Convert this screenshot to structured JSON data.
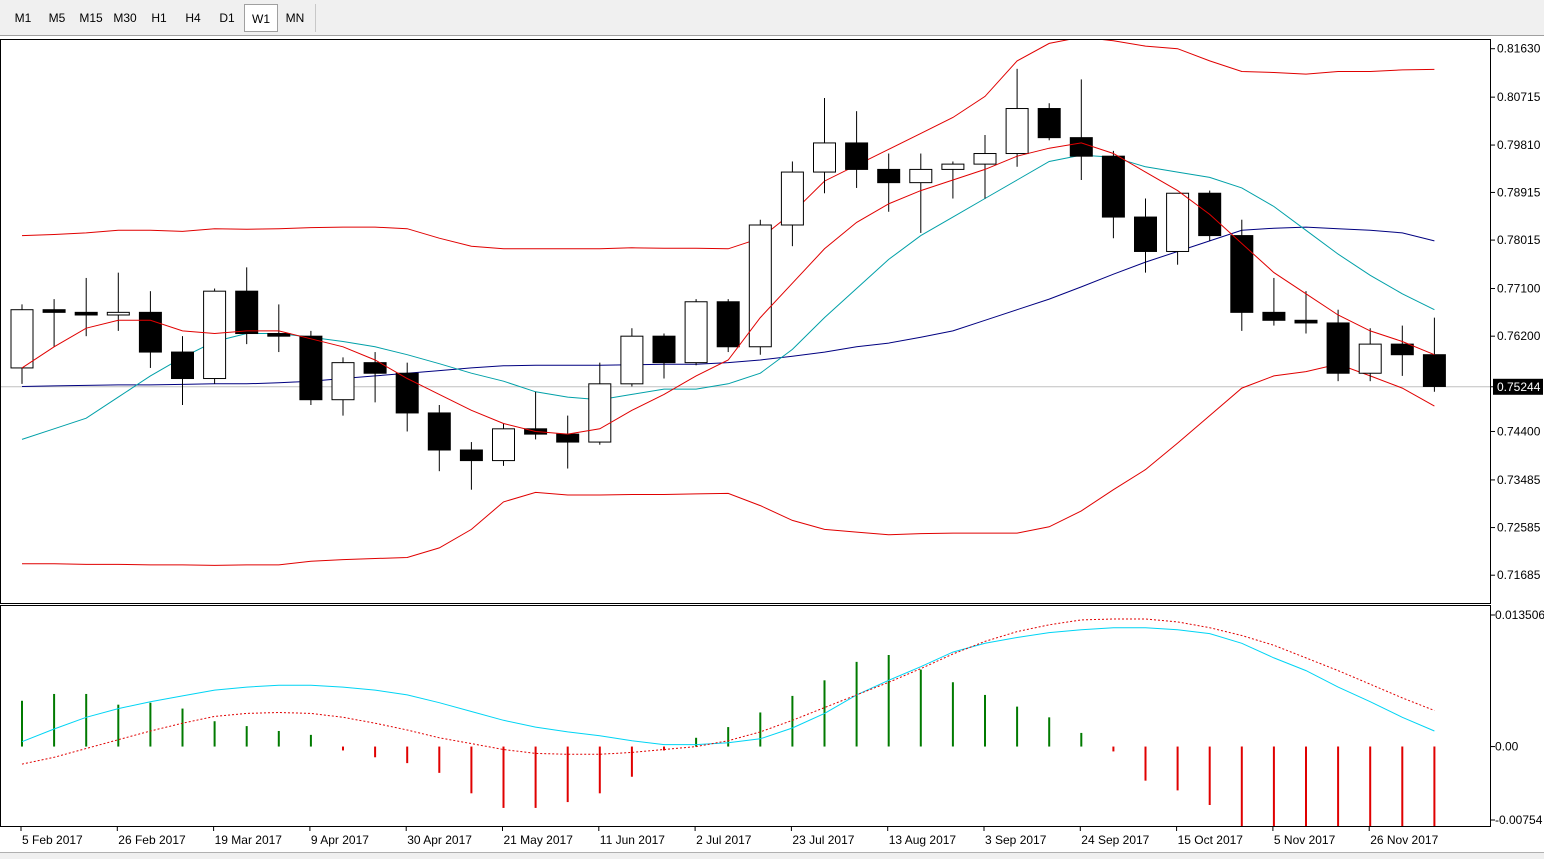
{
  "toolbar": {
    "timeframes": [
      {
        "label": "M1",
        "active": false
      },
      {
        "label": "M5",
        "active": false
      },
      {
        "label": "M15",
        "active": false
      },
      {
        "label": "M30",
        "active": false
      },
      {
        "label": "H1",
        "active": false
      },
      {
        "label": "H4",
        "active": false
      },
      {
        "label": "D1",
        "active": false
      },
      {
        "label": "W1",
        "active": true
      },
      {
        "label": "MN",
        "active": false
      }
    ]
  },
  "chart_data": [
    {
      "type": "candlestick",
      "timeframe": "W1",
      "y_ticks": [
        "0.81630",
        "0.80715",
        "0.79810",
        "0.78915",
        "0.78015",
        "0.77100",
        "0.76200",
        "0.75244",
        "0.74400",
        "0.73485",
        "0.72585",
        "0.71685"
      ],
      "ylim": [
        0.715,
        0.817
      ],
      "current_price": "0.75244",
      "candles": [
        {
          "o": 0.756,
          "h": 0.768,
          "l": 0.753,
          "c": 0.767
        },
        {
          "o": 0.767,
          "h": 0.769,
          "l": 0.76,
          "c": 0.7665
        },
        {
          "o": 0.7665,
          "h": 0.773,
          "l": 0.762,
          "c": 0.766
        },
        {
          "o": 0.766,
          "h": 0.774,
          "l": 0.763,
          "c": 0.7665
        },
        {
          "o": 0.7665,
          "h": 0.7705,
          "l": 0.756,
          "c": 0.759
        },
        {
          "o": 0.759,
          "h": 0.762,
          "l": 0.749,
          "c": 0.754
        },
        {
          "o": 0.754,
          "h": 0.771,
          "l": 0.753,
          "c": 0.7705
        },
        {
          "o": 0.7705,
          "h": 0.775,
          "l": 0.7605,
          "c": 0.7625
        },
        {
          "o": 0.7625,
          "h": 0.768,
          "l": 0.759,
          "c": 0.762
        },
        {
          "o": 0.762,
          "h": 0.763,
          "l": 0.749,
          "c": 0.75
        },
        {
          "o": 0.75,
          "h": 0.758,
          "l": 0.747,
          "c": 0.757
        },
        {
          "o": 0.757,
          "h": 0.759,
          "l": 0.7495,
          "c": 0.755
        },
        {
          "o": 0.755,
          "h": 0.757,
          "l": 0.744,
          "c": 0.7475
        },
        {
          "o": 0.7475,
          "h": 0.749,
          "l": 0.7365,
          "c": 0.7405
        },
        {
          "o": 0.7405,
          "h": 0.742,
          "l": 0.733,
          "c": 0.7385
        },
        {
          "o": 0.7385,
          "h": 0.7455,
          "l": 0.7375,
          "c": 0.7445
        },
        {
          "o": 0.7445,
          "h": 0.7515,
          "l": 0.7425,
          "c": 0.7435
        },
        {
          "o": 0.7435,
          "h": 0.747,
          "l": 0.737,
          "c": 0.742
        },
        {
          "o": 0.742,
          "h": 0.757,
          "l": 0.7415,
          "c": 0.753
        },
        {
          "o": 0.753,
          "h": 0.7635,
          "l": 0.7525,
          "c": 0.762
        },
        {
          "o": 0.762,
          "h": 0.7625,
          "l": 0.754,
          "c": 0.757
        },
        {
          "o": 0.757,
          "h": 0.769,
          "l": 0.7565,
          "c": 0.7685
        },
        {
          "o": 0.7685,
          "h": 0.769,
          "l": 0.759,
          "c": 0.76
        },
        {
          "o": 0.76,
          "h": 0.784,
          "l": 0.7585,
          "c": 0.783
        },
        {
          "o": 0.783,
          "h": 0.795,
          "l": 0.779,
          "c": 0.793
        },
        {
          "o": 0.793,
          "h": 0.807,
          "l": 0.789,
          "c": 0.7985
        },
        {
          "o": 0.7985,
          "h": 0.8045,
          "l": 0.79,
          "c": 0.7935
        },
        {
          "o": 0.7935,
          "h": 0.7965,
          "l": 0.7855,
          "c": 0.791
        },
        {
          "o": 0.791,
          "h": 0.7965,
          "l": 0.7815,
          "c": 0.7935
        },
        {
          "o": 0.7935,
          "h": 0.795,
          "l": 0.788,
          "c": 0.7945
        },
        {
          "o": 0.7945,
          "h": 0.8,
          "l": 0.788,
          "c": 0.7965
        },
        {
          "o": 0.7965,
          "h": 0.8125,
          "l": 0.794,
          "c": 0.805
        },
        {
          "o": 0.805,
          "h": 0.806,
          "l": 0.799,
          "c": 0.7995
        },
        {
          "o": 0.7995,
          "h": 0.8105,
          "l": 0.7915,
          "c": 0.796
        },
        {
          "o": 0.796,
          "h": 0.797,
          "l": 0.7805,
          "c": 0.7845
        },
        {
          "o": 0.7845,
          "h": 0.788,
          "l": 0.774,
          "c": 0.778
        },
        {
          "o": 0.778,
          "h": 0.789,
          "l": 0.7755,
          "c": 0.789
        },
        {
          "o": 0.789,
          "h": 0.7895,
          "l": 0.78,
          "c": 0.781
        },
        {
          "o": 0.781,
          "h": 0.784,
          "l": 0.763,
          "c": 0.7665
        },
        {
          "o": 0.7665,
          "h": 0.773,
          "l": 0.764,
          "c": 0.765
        },
        {
          "o": 0.765,
          "h": 0.7705,
          "l": 0.7625,
          "c": 0.7645
        },
        {
          "o": 0.7645,
          "h": 0.767,
          "l": 0.7535,
          "c": 0.755
        },
        {
          "o": 0.755,
          "h": 0.7635,
          "l": 0.7535,
          "c": 0.7605
        },
        {
          "o": 0.7605,
          "h": 0.764,
          "l": 0.7545,
          "c": 0.7585
        },
        {
          "o": 0.7585,
          "h": 0.7655,
          "l": 0.7515,
          "c": 0.7525
        }
      ],
      "bb_upper": [
        0.781,
        0.7812,
        0.7815,
        0.782,
        0.782,
        0.7818,
        0.7823,
        0.7822,
        0.7823,
        0.7825,
        0.7826,
        0.7826,
        0.7823,
        0.7805,
        0.779,
        0.7785,
        0.7785,
        0.7785,
        0.7785,
        0.7787,
        0.7786,
        0.7786,
        0.7785,
        0.7805,
        0.7853,
        0.7913,
        0.7943,
        0.7973,
        0.8003,
        0.8033,
        0.8073,
        0.814,
        0.8173,
        0.8185,
        0.8178,
        0.8168,
        0.8163,
        0.814,
        0.812,
        0.8118,
        0.8115,
        0.812,
        0.812,
        0.8123,
        0.8124
      ],
      "bb_lower": [
        0.719,
        0.719,
        0.7189,
        0.7189,
        0.7188,
        0.7188,
        0.7187,
        0.7188,
        0.7188,
        0.7195,
        0.7198,
        0.72,
        0.7202,
        0.722,
        0.7255,
        0.7307,
        0.7325,
        0.732,
        0.732,
        0.7321,
        0.7321,
        0.7322,
        0.7323,
        0.73,
        0.7272,
        0.7255,
        0.725,
        0.7245,
        0.7247,
        0.7248,
        0.7248,
        0.7248,
        0.726,
        0.729,
        0.733,
        0.7368,
        0.7418,
        0.747,
        0.7522,
        0.7545,
        0.7553,
        0.7567,
        0.7545,
        0.7522,
        0.7488
      ],
      "ma_red": [
        0.756,
        0.76,
        0.7635,
        0.765,
        0.765,
        0.763,
        0.7625,
        0.763,
        0.763,
        0.7615,
        0.76,
        0.7575,
        0.754,
        0.751,
        0.748,
        0.7455,
        0.744,
        0.7435,
        0.7445,
        0.748,
        0.751,
        0.7545,
        0.7575,
        0.7655,
        0.772,
        0.7785,
        0.7835,
        0.787,
        0.7895,
        0.7915,
        0.7935,
        0.796,
        0.7975,
        0.7985,
        0.7965,
        0.793,
        0.7895,
        0.785,
        0.7795,
        0.774,
        0.77,
        0.766,
        0.763,
        0.761,
        0.7585
      ],
      "ma_teal": [
        0.7425,
        0.7445,
        0.7465,
        0.7505,
        0.7545,
        0.758,
        0.761,
        0.7625,
        0.7625,
        0.7618,
        0.761,
        0.76,
        0.7585,
        0.7568,
        0.755,
        0.7535,
        0.7515,
        0.7505,
        0.75,
        0.751,
        0.752,
        0.752,
        0.753,
        0.755,
        0.7595,
        0.7655,
        0.771,
        0.7765,
        0.781,
        0.7845,
        0.788,
        0.7915,
        0.795,
        0.7962,
        0.7958,
        0.794,
        0.793,
        0.792,
        0.79,
        0.7865,
        0.782,
        0.7775,
        0.7735,
        0.77,
        0.767
      ],
      "ma_navy": [
        0.7525,
        0.7526,
        0.7527,
        0.7528,
        0.7528,
        0.7529,
        0.753,
        0.753,
        0.7532,
        0.7535,
        0.754,
        0.7545,
        0.755,
        0.7555,
        0.756,
        0.7564,
        0.7565,
        0.7565,
        0.7565,
        0.7566,
        0.7567,
        0.7567,
        0.757,
        0.7575,
        0.7582,
        0.759,
        0.76,
        0.7607,
        0.7618,
        0.763,
        0.765,
        0.767,
        0.769,
        0.7713,
        0.7737,
        0.776,
        0.778,
        0.78,
        0.782,
        0.7824,
        0.7826,
        0.7823,
        0.782,
        0.7815,
        0.78
      ]
    },
    {
      "type": "histogram",
      "y_ticks": [
        "0.013506",
        "0.00",
        "-0.00754"
      ],
      "ylim": [
        -0.00754,
        0.013506
      ],
      "histogram": [
        0.0047,
        0.0054,
        0.0054,
        0.0043,
        0.0045,
        0.0039,
        0.0026,
        0.0021,
        0.0016,
        0.0012,
        -0.0004,
        -0.0011,
        -0.0017,
        -0.0027,
        -0.0048,
        -0.0063,
        -0.0063,
        -0.0057,
        -0.0048,
        -0.0031,
        -0.0004,
        0.0009,
        0.002,
        0.0035,
        0.0052,
        0.0068,
        0.0087,
        0.0094,
        0.0079,
        0.0066,
        0.0053,
        0.0041,
        0.003,
        0.0014,
        -0.0005,
        -0.0035,
        -0.0045,
        -0.006,
        -0.0085,
        -0.0105,
        -0.0112,
        -0.012,
        -0.0115,
        -0.0108,
        -0.0106
      ],
      "signal": [
        0.0005,
        0.0018,
        0.003,
        0.0039,
        0.0046,
        0.0052,
        0.0058,
        0.0061,
        0.0063,
        0.0063,
        0.0061,
        0.0058,
        0.0053,
        0.0045,
        0.0036,
        0.0027,
        0.002,
        0.0015,
        0.0011,
        0.0006,
        0.0002,
        0.0002,
        0.0004,
        0.0008,
        0.0019,
        0.0034,
        0.0053,
        0.0068,
        0.0082,
        0.0097,
        0.0106,
        0.0112,
        0.0117,
        0.012,
        0.0122,
        0.0122,
        0.012,
        0.0116,
        0.0106,
        0.0091,
        0.0078,
        0.0061,
        0.0046,
        0.003,
        0.0016
      ],
      "signal_dotted": [
        -0.0018,
        -0.0011,
        -0.0002,
        0.0007,
        0.0016,
        0.0024,
        0.0031,
        0.0034,
        0.0035,
        0.0034,
        0.003,
        0.0024,
        0.0017,
        0.0009,
        0.0003,
        -0.0003,
        -0.0007,
        -0.0008,
        -0.0008,
        -0.0006,
        -0.0003,
        0.0,
        0.0006,
        0.0015,
        0.0027,
        0.004,
        0.0053,
        0.0066,
        0.008,
        0.0095,
        0.0108,
        0.0118,
        0.0125,
        0.013,
        0.0131,
        0.0131,
        0.0128,
        0.0122,
        0.0114,
        0.0104,
        0.0091,
        0.0078,
        0.0064,
        0.005,
        0.0037
      ]
    }
  ],
  "x_ticks": [
    {
      "label": "5 Feb 2017",
      "bar": 0
    },
    {
      "label": "26 Feb 2017",
      "bar": 3
    },
    {
      "label": "19 Mar 2017",
      "bar": 6
    },
    {
      "label": "9 Apr 2017",
      "bar": 9
    },
    {
      "label": "30 Apr 2017",
      "bar": 12
    },
    {
      "label": "21 May 2017",
      "bar": 15
    },
    {
      "label": "11 Jun 2017",
      "bar": 18
    },
    {
      "label": "2 Jul 2017",
      "bar": 21
    },
    {
      "label": "23 Jul 2017",
      "bar": 24
    },
    {
      "label": "13 Aug 2017",
      "bar": 27
    },
    {
      "label": "3 Sep 2017",
      "bar": 30
    },
    {
      "label": "24 Sep 2017",
      "bar": 33
    },
    {
      "label": "15 Oct 2017",
      "bar": 36
    },
    {
      "label": "5 Nov 2017",
      "bar": 39
    },
    {
      "label": "26 Nov 2017",
      "bar": 42
    }
  ],
  "colors": {
    "bull_body": "#ffffff",
    "bear_body": "#000000",
    "candle_outline": "#000000",
    "bollinger": "#e00000",
    "ma_red": "#e00000",
    "ma_teal": "#00a0a8",
    "ma_navy": "#000080",
    "hist_up": "#007a00",
    "hist_down": "#e00000",
    "signal": "#00d4f4",
    "signal_dotted": "#e00000",
    "price_line": "#c0c0c0",
    "frame": "#000000",
    "background": "#ffffff"
  }
}
